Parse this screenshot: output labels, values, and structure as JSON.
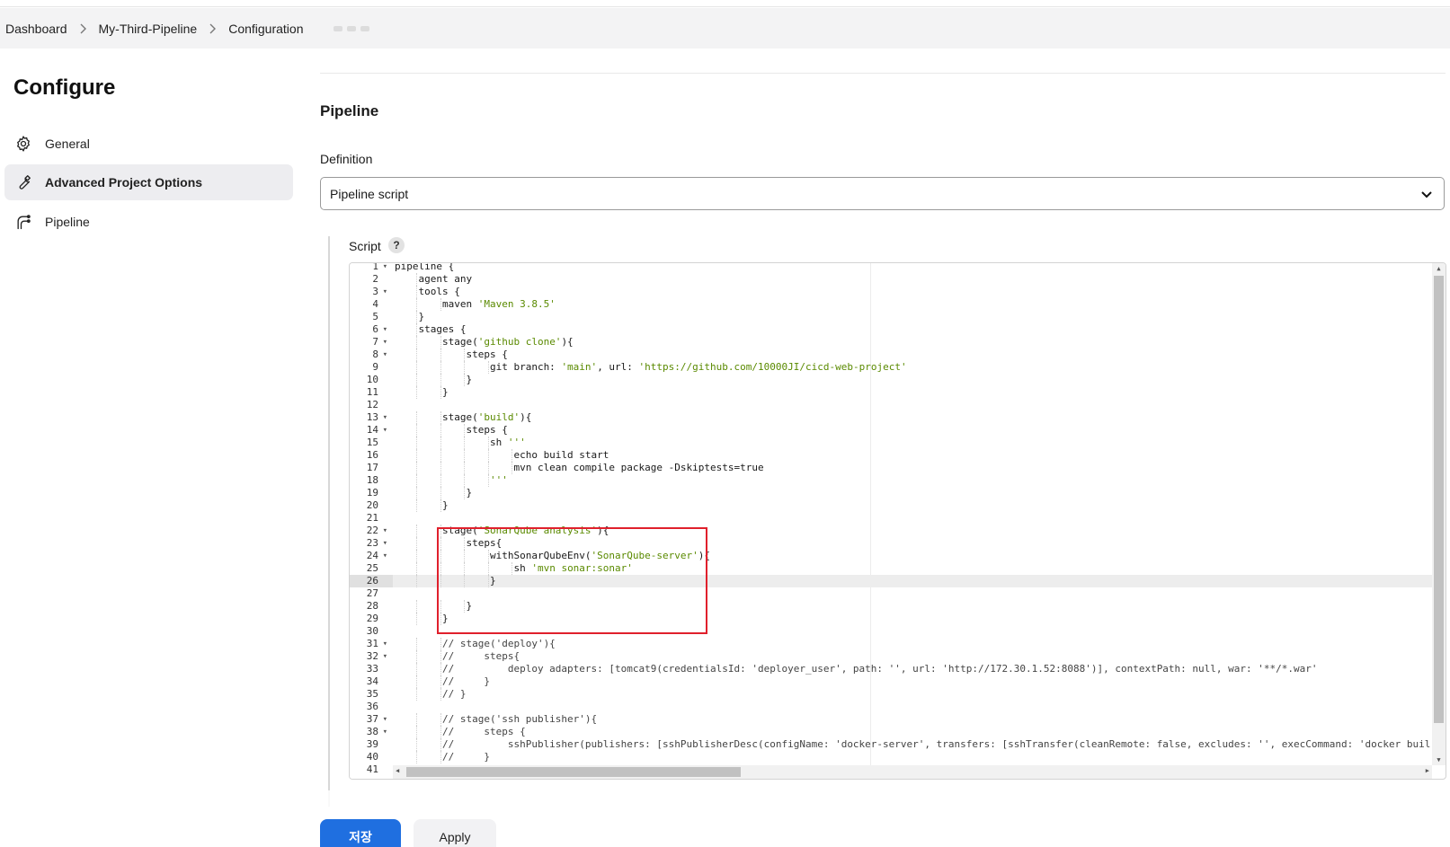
{
  "breadcrumb": {
    "items": [
      "Dashboard",
      "My-Third-Pipeline",
      "Configuration"
    ]
  },
  "sidebar": {
    "title": "Configure",
    "items": [
      {
        "label": "General",
        "icon": "gear-icon"
      },
      {
        "label": "Advanced Project Options",
        "icon": "wrench-icon",
        "active": true
      },
      {
        "label": "Pipeline",
        "icon": "pipeline-icon"
      }
    ]
  },
  "main": {
    "section_title": "Pipeline",
    "definition_label": "Definition",
    "definition_value": "Pipeline script",
    "script_label": "Script",
    "help_label": "?"
  },
  "editor": {
    "active_line": 26,
    "fold_lines": [
      1,
      3,
      6,
      7,
      8,
      13,
      14,
      22,
      23,
      24,
      31,
      32,
      37,
      38
    ],
    "lines": [
      "pipeline {",
      "    agent any",
      "    tools {",
      "        maven 'Maven 3.8.5'",
      "    }",
      "    stages {",
      "        stage('github clone'){",
      "            steps {",
      "                git branch: 'main', url: 'https://github.com/10000JI/cicd-web-project'",
      "            }",
      "        }",
      "",
      "        stage('build'){",
      "            steps {",
      "                sh '''",
      "                    echo build start",
      "                    mvn clean compile package -Dskiptests=true",
      "                '''",
      "            }",
      "        }",
      "",
      "        stage('SonarQube analysis'){",
      "            steps{",
      "                withSonarQubeEnv('SonarQube-server'){",
      "                    sh 'mvn sonar:sonar'",
      "                }",
      "",
      "            }",
      "        }",
      "",
      "        // stage('deploy'){",
      "        //     steps{",
      "        //         deploy adapters: [tomcat9(credentialsId: 'deployer_user', path: '', url: 'http://172.30.1.52:8088')], contextPath: null, war: '**/*.war'",
      "        //     }",
      "        // }",
      "",
      "        // stage('ssh publisher'){",
      "        //     steps {",
      "        //         sshPublisher(publishers: [sshPublisherDesc(configName: 'docker-server', transfers: [sshTransfer(cleanRemote: false, excludes: '', execCommand: 'docker buil",
      "        //     }",
      ""
    ]
  },
  "buttons": {
    "save": "저장",
    "apply": "Apply"
  },
  "colors": {
    "primary": "#1f6fe0",
    "highlight": "#e0202c",
    "string": "#5a8a00"
  }
}
